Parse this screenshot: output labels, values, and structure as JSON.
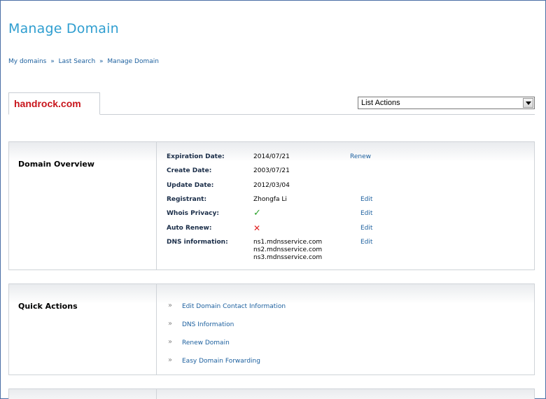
{
  "page": {
    "title": "Manage Domain"
  },
  "breadcrumb": {
    "items": [
      "My domains",
      "Last Search",
      "Manage Domain"
    ],
    "separator": "»"
  },
  "domain_tab": {
    "label": "handrock.com"
  },
  "list_actions": {
    "selected": "List Actions"
  },
  "overview": {
    "heading": "Domain Overview",
    "rows": [
      {
        "label": "Expiration Date:",
        "value": "2014/07/21",
        "action": "Renew"
      },
      {
        "label": "Create Date:",
        "value": "2003/07/21",
        "action": ""
      },
      {
        "label": "Update Date:",
        "value": "2012/03/04",
        "action": ""
      },
      {
        "label": "Registrant:",
        "value": "Zhongfa Li",
        "action": "Edit"
      },
      {
        "label": "Whois Privacy:",
        "value": "✓",
        "action": "Edit"
      },
      {
        "label": "Auto Renew:",
        "value": "✕",
        "action": "Edit"
      },
      {
        "label": "DNS information:",
        "value": "",
        "action": "Edit"
      }
    ],
    "dns_servers": [
      "ns1.mdnsservice.com",
      "ns2.mdnsservice.com",
      "ns3.mdnsservice.com"
    ],
    "icons": {
      "whois_privacy": "check-icon",
      "auto_renew": "cross-icon"
    },
    "colors": {
      "check": "#2aa12a",
      "cross": "#e02020"
    }
  },
  "quick_actions": {
    "heading": "Quick Actions",
    "bullet": "»",
    "items": [
      "Edit Domain Contact Information",
      "DNS Information",
      "Renew Domain",
      "Easy Domain Forwarding"
    ]
  },
  "colors": {
    "title": "#2f9ed0",
    "link": "#1b5f9e",
    "domain": "#c8141b",
    "border": "#cfd3d8"
  }
}
